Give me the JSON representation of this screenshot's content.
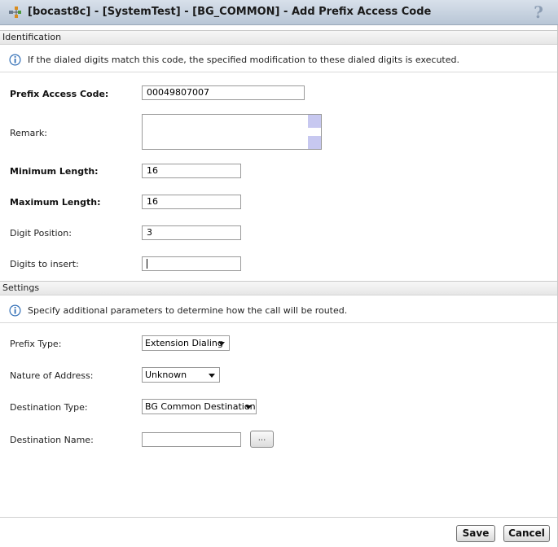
{
  "window": {
    "title": "[bocast8c] - [SystemTest] - [BG_COMMON] - Add Prefix Access Code",
    "help_label": "?"
  },
  "identification": {
    "header": "Identification",
    "info": "If the dialed digits match this code, the specified modification to these dialed digits is executed.",
    "prefix_access_code": {
      "label": "Prefix Access Code:",
      "value": "00049807007"
    },
    "remark": {
      "label": "Remark:",
      "value": ""
    },
    "minimum_length": {
      "label": "Minimum Length:",
      "value": "16"
    },
    "maximum_length": {
      "label": "Maximum Length:",
      "value": "16"
    },
    "digit_position": {
      "label": "Digit Position:",
      "value": "3"
    },
    "digits_to_insert": {
      "label": "Digits to insert:",
      "value": ""
    }
  },
  "settings": {
    "header": "Settings",
    "info": "Specify additional parameters to determine how the call will be routed.",
    "prefix_type": {
      "label": "Prefix Type:",
      "value": "Extension Dialing"
    },
    "nature_of_address": {
      "label": "Nature of Address:",
      "value": "Unknown"
    },
    "destination_type": {
      "label": "Destination Type:",
      "value": "BG Common Destination"
    },
    "destination_name": {
      "label": "Destination Name:",
      "value": "",
      "browse_label": "..."
    }
  },
  "footer": {
    "save_label": "Save",
    "cancel_label": "Cancel"
  },
  "colors": {
    "title_bar": "#c8d3e0",
    "info_icon": "#2f6db5",
    "scroll_buttons": "#c7c8f0"
  },
  "icons": {
    "app": "network-nodes-icon",
    "info": "info-icon",
    "help": "help-icon",
    "dropdown": "chevron-down-icon"
  }
}
